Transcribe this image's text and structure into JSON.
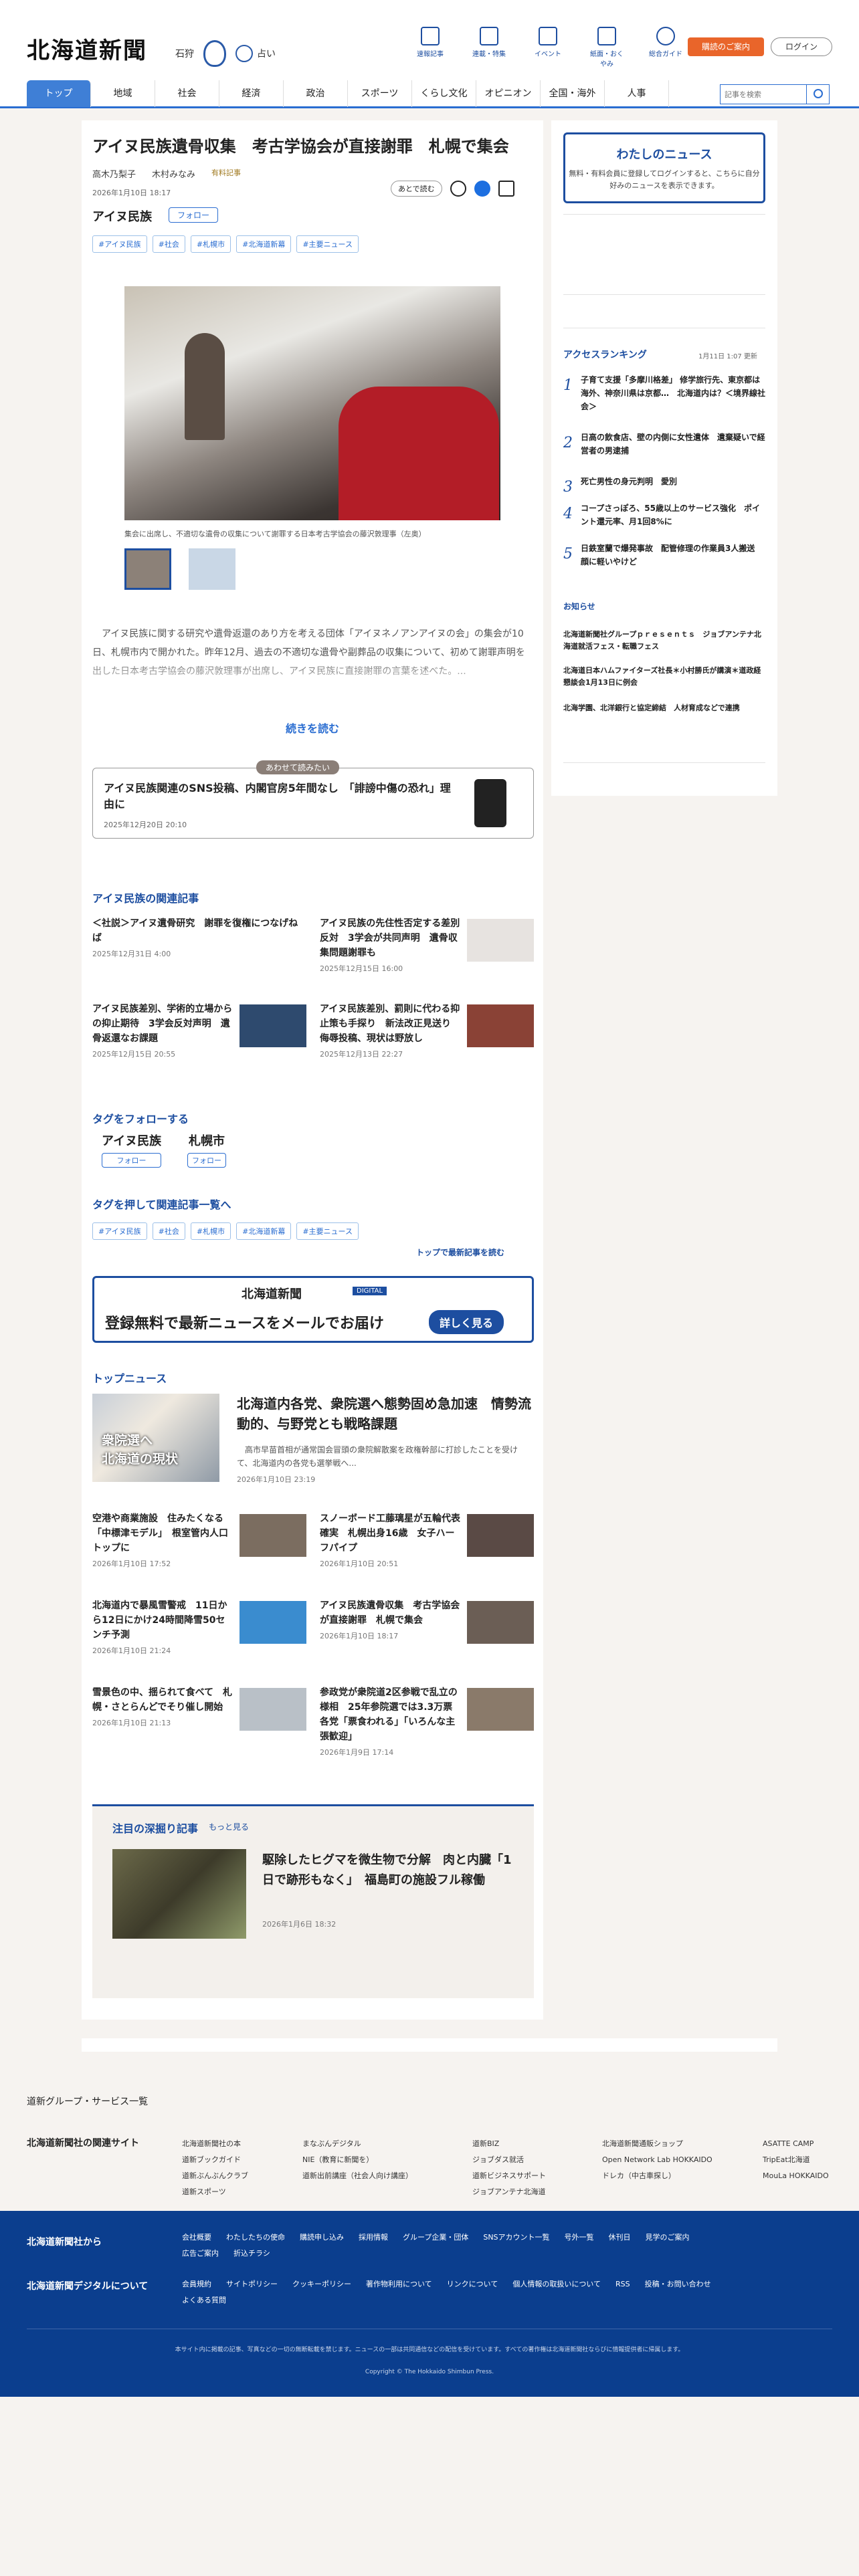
{
  "header": {
    "logo": "北海道新聞",
    "city": "石狩",
    "fortune": "占い",
    "icons": [
      "速報記事",
      "連載・特集",
      "イベント",
      "紙面・おくやみ",
      "総合ガイド"
    ],
    "register": "購読のご案内",
    "login": "ログイン"
  },
  "nav": {
    "items": [
      "トップ",
      "地域",
      "社会",
      "経済",
      "政治",
      "スポーツ",
      "くらし文化",
      "オピニオン",
      "全国・海外",
      "人事"
    ],
    "search_placeholder": "記事を検索"
  },
  "article": {
    "title": "アイヌ民族遺骨収集　考古学協会が直接謝罪　札幌で集会",
    "authors": [
      "高木乃梨子",
      "木村みなみ"
    ],
    "member_label": "有料記事",
    "date": "2026年1月10日 18:17",
    "later": "あとで読む",
    "tag_title": "アイヌ民族",
    "follow": "フォロー",
    "tags": [
      "#アイヌ民族",
      "#社会",
      "#札幌市",
      "#北海道新幕",
      "#主要ニュース"
    ],
    "caption": "集会に出席し、不適切な遺骨の収集について謝罪する日本考古学協会の藤沢敦理事（左奥）",
    "lead": "　アイヌ民族に関する研究や遺骨返還のあり方を考える団体「アイヌネノアンアイヌの会」の集会が10日、札幌市内で開かれた。昨年12月、過去の不適切な遺骨や副葬品の収集について、初めて謝罪声明を出した日本考古学協会の藤沢敦理事が出席し、アイヌ民族に直接謝罪の言葉を述べた。...",
    "more": "続きを読む"
  },
  "recommend": {
    "badge": "あわせて読みたい",
    "title": "アイヌ民族関連のSNS投稿、内閣官房5年間なし　「誹謗中傷の恐れ」理由に",
    "date": "2025年12月20日 20:10"
  },
  "related": {
    "heading": "アイヌ民族の関連記事",
    "items": [
      {
        "title": "＜社説＞アイヌ遺骨研究　謝罪を復権につなげねば",
        "date": "2025年12月31日 4:00"
      },
      {
        "title": "アイヌ民族の先住性否定する差別反対　3学会が共同声明　遺骨収集問題謝罪も",
        "date": "2025年12月15日 16:00"
      },
      {
        "title": "アイヌ民族差別、学術的立場からの抑止期待　3学会反対声明　遺骨返還なお課題",
        "date": "2025年12月15日 20:55"
      },
      {
        "title": "アイヌ民族差別、罰則に代わる抑止策も手探り　新法改正見送り　侮辱投稿、現状は野放し",
        "date": "2025年12月13日 22:27"
      }
    ]
  },
  "follow_tags": {
    "heading": "タグをフォローする",
    "tags": [
      "アイヌ民族",
      "札幌市"
    ],
    "button": "フォロー"
  },
  "tag_list": {
    "heading": "タグを押して関連記事一覧へ",
    "tags": [
      "#アイヌ民族",
      "#社会",
      "#札幌市",
      "#北海道新幕",
      "#主要ニュース"
    ],
    "latest": "トップで最新記事を読む"
  },
  "mail": {
    "brand": "北海道新聞",
    "digital": "DIGITAL",
    "message": "登録無料で最新ニュースをメールでお届け",
    "button": "詳しく見る"
  },
  "top_news": {
    "heading": "トップニュース",
    "lead": {
      "img_text": "衆院選へ\n北海道の現状",
      "title": "北海道内各党、衆院選へ態勢固め急加速　情勢流動的、与野党とも戦略課題",
      "summary": "　高市早苗首相が通常国会冒頭の衆院解散案を政権幹部に打診したことを受けて、北海道内の各党も選挙戦へ...",
      "date": "2026年1月10日 23:19"
    },
    "items": [
      {
        "title": "空港や商業施設　住みたくなる「中標津モデル」　根室管内人口トップに",
        "date": "2026年1月10日 17:52"
      },
      {
        "title": "スノーボード工藤璃星が五輪代表確実　札幌出身16歳　女子ハーフパイプ",
        "date": "2026年1月10日 20:51"
      },
      {
        "title": "北海道内で暴風雪警戒　11日から12日にかけ24時間降雪50センチ予測",
        "date": "2026年1月10日 21:24"
      },
      {
        "title": "アイヌ民族遺骨収集　考古学協会が直接謝罪　札幌で集会",
        "date": "2026年1月10日 18:17"
      },
      {
        "title": "雪景色の中、揺られて食べて　札幌・さとらんどでそり催し開始",
        "date": "2026年1月10日 21:13"
      },
      {
        "title": "参政党が衆院道2区参戦で乱立の様相　25年参院選では3.3万票　各党「票食われる」「いろんな主張歓迎」",
        "date": "2026年1月9日 17:14"
      }
    ]
  },
  "deep": {
    "heading": "注目の深掘り記事",
    "more": "もっと見る",
    "title": "駆除したヒグマを微生物で分解　肉と内臓「1日で跡形もなく」　福島町の施設フル稼働",
    "date": "2026年1月6日 18:32"
  },
  "sidebar": {
    "my_title": "わたしのニュース",
    "my_text": "無料・有料会員に登録してログインすると、こちらに自分好みのニュースを表示できます。",
    "ranking_heading": "アクセスランキング",
    "ranking_updated": "1月11日 1:07 更新",
    "ranking": [
      "子育て支援「多摩川格差」 修学旅行先、東京都は海外、神奈川県は京都…　北海道内は？＜境界線社会＞",
      "日高の飲食店、壁の内側に女性遺体　遺棄疑いで経営者の男逮捕",
      "死亡男性の身元判明　愛別",
      "コープさっぽろ、55歳以上のサービス強化　ポイント還元率、月1回8%に",
      "日鉄室蘭で爆発事故　配管修理の作業員3人搬送　顔に軽いやけど"
    ],
    "notice_heading": "お知らせ",
    "notices": [
      "北海道新聞社グループｐｒｅｓｅｎｔｓ　ジョブアンテナ北海道就活フェス・転職フェス",
      "北海道日本ハムファイターズ社長＊小村勝氏が講演＊道政経懇談会1月13日に例会",
      "北海学園、北洋銀行と協定締結　人材育成などで連携"
    ]
  },
  "footer": {
    "group_services": "道新グループ・サービス一覧",
    "related_sites_heading": "北海道新聞社の関連サイト",
    "related_sites": [
      [
        "北海道新聞社の本",
        "道新ブックガイド",
        "道新ぶんぶんクラブ",
        "道新スポーツ"
      ],
      [
        "まなぶんデジタル",
        "NIE（教育に新聞を）",
        "道新出前講座（社会人向け講座）"
      ],
      [
        "道新BIZ",
        "ジョブダス就活",
        "道新ビジネスサポート",
        "ジョブアンテナ北海道"
      ],
      [
        "北海道新聞通販ショップ",
        "Open Network Lab HOKKAIDO",
        "ドレカ（中古車探し）"
      ],
      [
        "ASATTE CAMP",
        "TripEat北海道",
        "MouLa HOKKAIDO"
      ]
    ],
    "company_heading": "北海道新聞社から",
    "company_links": [
      "会社概要",
      "わたしたちの使命",
      "購読申し込み",
      "採用情報",
      "グループ企業・団体",
      "SNSアカウント一覧",
      "号外一覧",
      "休刊日",
      "見学のご案内",
      "広告ご案内",
      "折込チラシ"
    ],
    "digital_heading": "北海道新聞デジタルについて",
    "digital_links": [
      "会員規約",
      "サイトポリシー",
      "クッキーポリシー",
      "著作物利用について",
      "リンクについて",
      "個人情報の取扱いについて",
      "RSS",
      "投稿・お問い合わせ",
      "よくある質問"
    ],
    "disclaimer": "本サイト内に掲載の記事、写真などの一切の無断転載を禁じます。ニュースの一部は共同通信などの配信を受けています。すべての著作権は北海道新聞社ならびに情報提供者に帰属します。",
    "copyright": "Copyright © The Hokkaido Shimbun Press."
  }
}
